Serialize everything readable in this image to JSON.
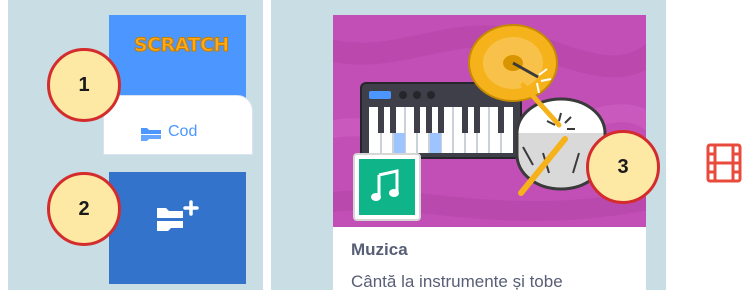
{
  "scratch_header": {
    "logo_text": "SCRATCH"
  },
  "code_tab": {
    "label": "Cod"
  },
  "extension_card": {
    "title": "Muzica",
    "description": "Cântă la instrumente și tobe"
  },
  "markers": [
    "1",
    "2",
    "3"
  ],
  "colors": {
    "scratch_blue": "#4c97ff",
    "extension_blue": "#3373cc",
    "music_purple": "#c24fb6",
    "music_green": "#0fb489",
    "marker_red": "#d42c2c",
    "marker_fill": "#fde8a4",
    "panel_bg": "#c9dde4"
  },
  "icons": [
    "code-blocks-icon",
    "add-extension-icon",
    "keyboard-icon",
    "cymbal-icon",
    "drum-icon",
    "music-notes-icon",
    "film-icon"
  ]
}
